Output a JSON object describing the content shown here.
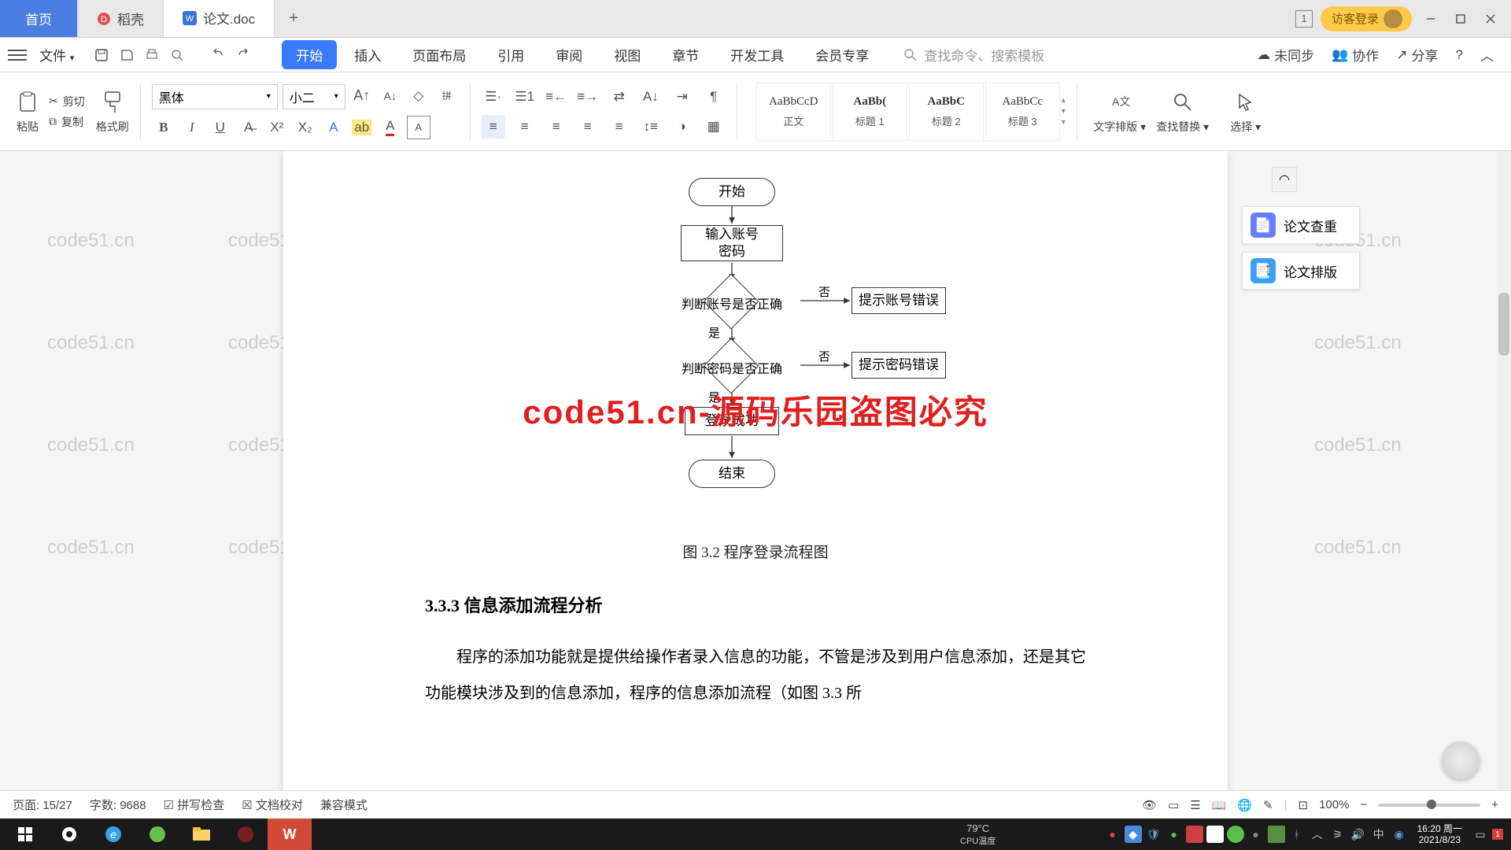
{
  "tabs": {
    "home": "首页",
    "daoke": "稻壳",
    "doc": "论文.doc"
  },
  "titlebar": {
    "badge": "1",
    "login": "访客登录"
  },
  "menu": {
    "file": "文件",
    "tabs": [
      "开始",
      "插入",
      "页面布局",
      "引用",
      "审阅",
      "视图",
      "章节",
      "开发工具",
      "会员专享"
    ],
    "search_placeholder": "查找命令、搜索模板",
    "unsync": "未同步",
    "collab": "协作",
    "share": "分享"
  },
  "ribbon": {
    "paste": "粘贴",
    "cut": "剪切",
    "copy": "复制",
    "format_painter": "格式刷",
    "font_name": "黑体",
    "font_size": "小二",
    "styles": [
      {
        "preview": "AaBbCcD",
        "name": "正文"
      },
      {
        "preview": "AaBb(",
        "name": "标题 1",
        "bold": true
      },
      {
        "preview": "AaBbC",
        "name": "标题 2",
        "bold": true
      },
      {
        "preview": "AaBbCc",
        "name": "标题 3"
      }
    ],
    "text_layout": "文字排版",
    "find_replace": "查找替换",
    "select": "选择"
  },
  "doc": {
    "flowchart": {
      "start": "开始",
      "input": "输入账号\n密码",
      "check_account": "判断账号是否正确",
      "account_err": "提示账号错误",
      "check_pwd": "判断密码是否正确",
      "pwd_err": "提示密码错误",
      "success": "登录成功",
      "end": "结束",
      "yes": "是",
      "no": "否"
    },
    "caption": "图 3.2  程序登录流程图",
    "heading": "3.3.3  信息添加流程分析",
    "para": "程序的添加功能就是提供给操作者录入信息的功能，不管是涉及到用户信息添加，还是其它功能模块涉及到的信息添加，程序的信息添加流程（如图 3.3 所",
    "big_watermark": "code51.cn-源码乐园盗图必究"
  },
  "side": {
    "check": "论文查重",
    "layout": "论文排版"
  },
  "status": {
    "page": "页面: 15/27",
    "words": "字数: 9688",
    "spell": "拼写检查",
    "docproof": "文档校对",
    "compat": "兼容模式",
    "zoom": "100%"
  },
  "taskbar": {
    "temp_value": "79°C",
    "temp_label": "CPU温度",
    "time": "16:20 周一",
    "date": "2021/8/23"
  },
  "watermark_text": "code51.cn"
}
